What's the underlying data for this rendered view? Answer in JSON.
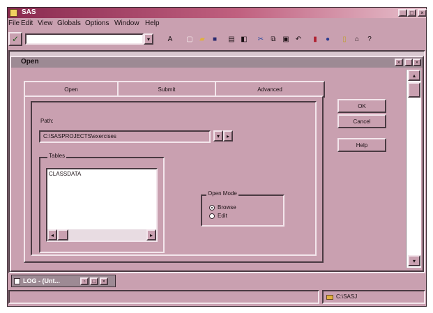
{
  "app": {
    "title": "SAS"
  },
  "menubar": {
    "items": [
      "File",
      "Edit",
      "View",
      "Globals",
      "Options",
      "Window",
      "Help"
    ]
  },
  "toolbar": {
    "command_value": ""
  },
  "dialog": {
    "title": "Open",
    "tabs": [
      "Open",
      "Submit",
      "Advanced"
    ],
    "path_label": "Path:",
    "path_value": "C:\\SASPROJECTS\\exercises",
    "tables_label": "Tables",
    "tables_items": [
      "CLASSDATA"
    ],
    "open_mode_label": "Open Mode",
    "open_mode_options": [
      "Browse",
      "Edit"
    ],
    "buttons": {
      "ok": "OK",
      "cancel": "Cancel",
      "help": "Help"
    }
  },
  "taskbar": {
    "log_label": "LOG - (Unt..."
  },
  "statusbar": {
    "path": "C:\\SASJ"
  },
  "colors": {
    "face": "#c9a0b0",
    "title_active": "#7a2a4a",
    "title_inactive": "#9d8a94",
    "workspace": "#d8c7cf"
  }
}
